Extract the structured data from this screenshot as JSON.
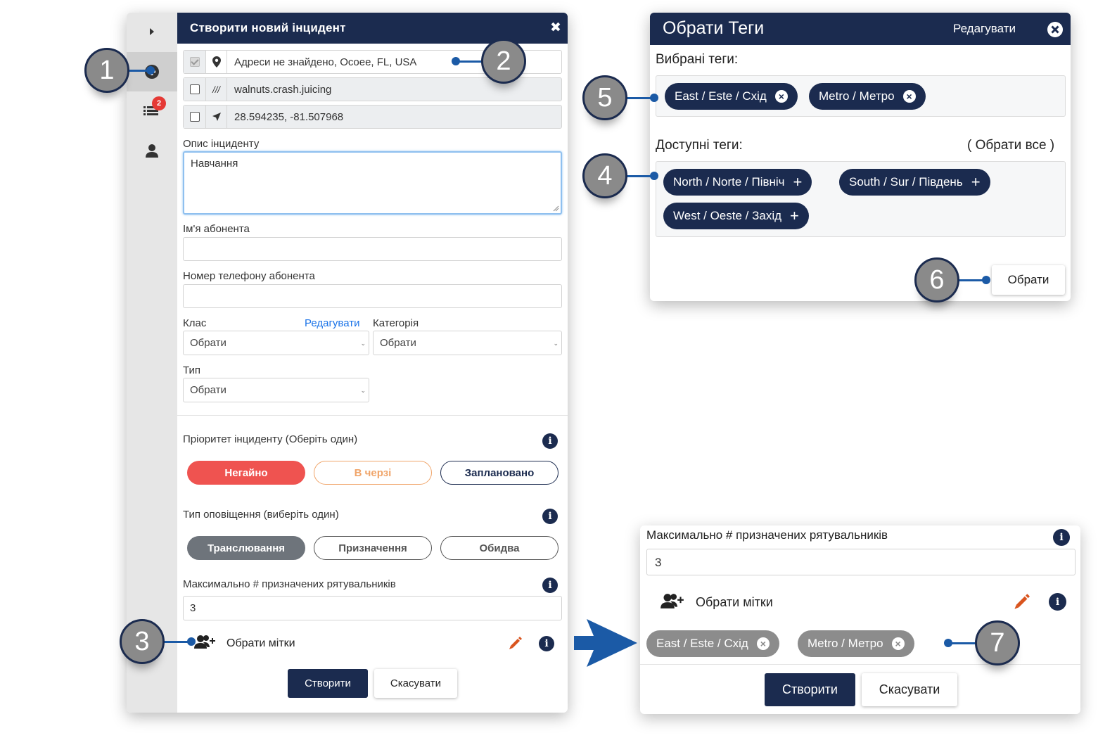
{
  "left_dialog": {
    "title": "Створити новий інцидент",
    "close_label": "✖",
    "sidebar": {
      "badge_count": "2"
    },
    "locations": [
      {
        "checked": true,
        "icon": "map-pin-icon",
        "text": "Адреси не знайдено,  Ocoee, FL, USA"
      },
      {
        "checked": false,
        "icon": "what3words-icon",
        "icon_glyph": "///",
        "text": "walnuts.crash.juicing"
      },
      {
        "checked": false,
        "icon": "navigation-arrow-icon",
        "text": "28.594235, -81.507968"
      }
    ],
    "description": {
      "label": "Опис інциденту",
      "value": "Навчання"
    },
    "caller_name": {
      "label": "Ім'я абонента",
      "value": ""
    },
    "caller_phone": {
      "label": "Номер телефону абонента",
      "value": ""
    },
    "class": {
      "label": "Клас",
      "edit_label": "Редагувати",
      "value": "Обрати"
    },
    "category": {
      "label": "Категорія",
      "value": "Обрати"
    },
    "type": {
      "label": "Тип",
      "value": "Обрати"
    },
    "priority": {
      "label": "Пріоритет інциденту (Оберіть один)",
      "options": [
        "Негайно",
        "В черзі",
        "Заплановано"
      ],
      "selected": "Негайно",
      "colors": {
        "urgent": "#ef5350",
        "queued": "#f0a56a",
        "scheduled": "#1b2b4f"
      }
    },
    "alert_type": {
      "label": "Тип оповіщення (виберіть один)",
      "options": [
        "Транслювання",
        "Призначення",
        "Обидва"
      ],
      "selected": "Транслювання"
    },
    "max_responders": {
      "label": "Максимально # призначених рятувальників",
      "value": "3"
    },
    "select_tags_label": "Обрати мітки",
    "create_label": "Створити",
    "cancel_label": "Скасувати"
  },
  "tags_dialog": {
    "title": "Обрати Теги",
    "edit_label": "Редагувати",
    "selected_label": "Вибрані теги:",
    "selected_tags": [
      "East / Este / Схід",
      "Metro / Метро"
    ],
    "available_label": "Доступні теги:",
    "select_all_label": "( Обрати все )",
    "available_tags": [
      "North / Norte / Північ",
      "South / Sur / Південь",
      "West / Oeste / Захід"
    ],
    "select_label": "Обрати"
  },
  "result_panel": {
    "max_responders_label": "Максимально # призначених рятувальників",
    "max_responders_value": "3",
    "select_tags_label": "Обрати мітки",
    "tags": [
      "East / Este / Схід",
      "Metro / Метро"
    ],
    "create_label": "Створити",
    "cancel_label": "Скасувати"
  },
  "callouts": [
    "1",
    "2",
    "3",
    "4",
    "5",
    "6",
    "7"
  ],
  "colors": {
    "navy": "#1b2b4f",
    "callout_gray": "#8a8a8a",
    "accent_blue": "#1b5aa6",
    "link_blue": "#1a73e8",
    "edit_orange": "#d9541e"
  }
}
